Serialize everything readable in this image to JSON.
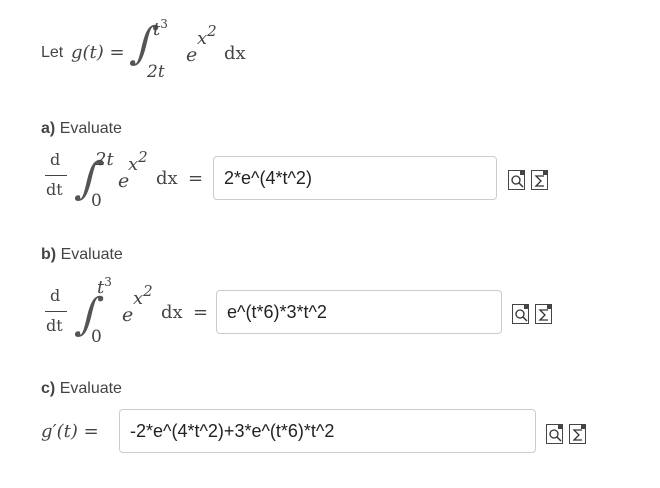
{
  "definition": {
    "prefix": "Let",
    "lhs": "g(t) =",
    "lower_limit": "2t",
    "upper_limit_base": "t",
    "upper_limit_exp": "3",
    "integrand_base": "e",
    "integrand_exp_var": "x",
    "integrand_exp_pow": "2",
    "differential": "dx"
  },
  "parts": [
    {
      "letter": "a)",
      "instruction": "Evaluate",
      "deriv_num": "d",
      "deriv_den": "dt",
      "lower_limit": "0",
      "upper_limit_base": "2t",
      "upper_limit_exp": "",
      "integrand_base": "e",
      "integrand_exp_var": "x",
      "integrand_exp_pow": "2",
      "differential": "dx",
      "equals": "=",
      "answer": "2*e^(4*t^2)"
    },
    {
      "letter": "b)",
      "instruction": "Evaluate",
      "deriv_num": "d",
      "deriv_den": "dt",
      "lower_limit": "0",
      "upper_limit_base": "t",
      "upper_limit_exp": "3",
      "integrand_base": "e",
      "integrand_exp_var": "x",
      "integrand_exp_pow": "2",
      "differential": "dx",
      "equals": "=",
      "answer": "e^(t*6)*3*t^2"
    },
    {
      "letter": "c)",
      "instruction": "Evaluate",
      "lhs": "g′(t) =",
      "answer": "-2*e^(4*t^2)+3*e^(t*6)*t^2"
    }
  ],
  "icons": [
    "preview-icon",
    "equation-editor-icon"
  ]
}
